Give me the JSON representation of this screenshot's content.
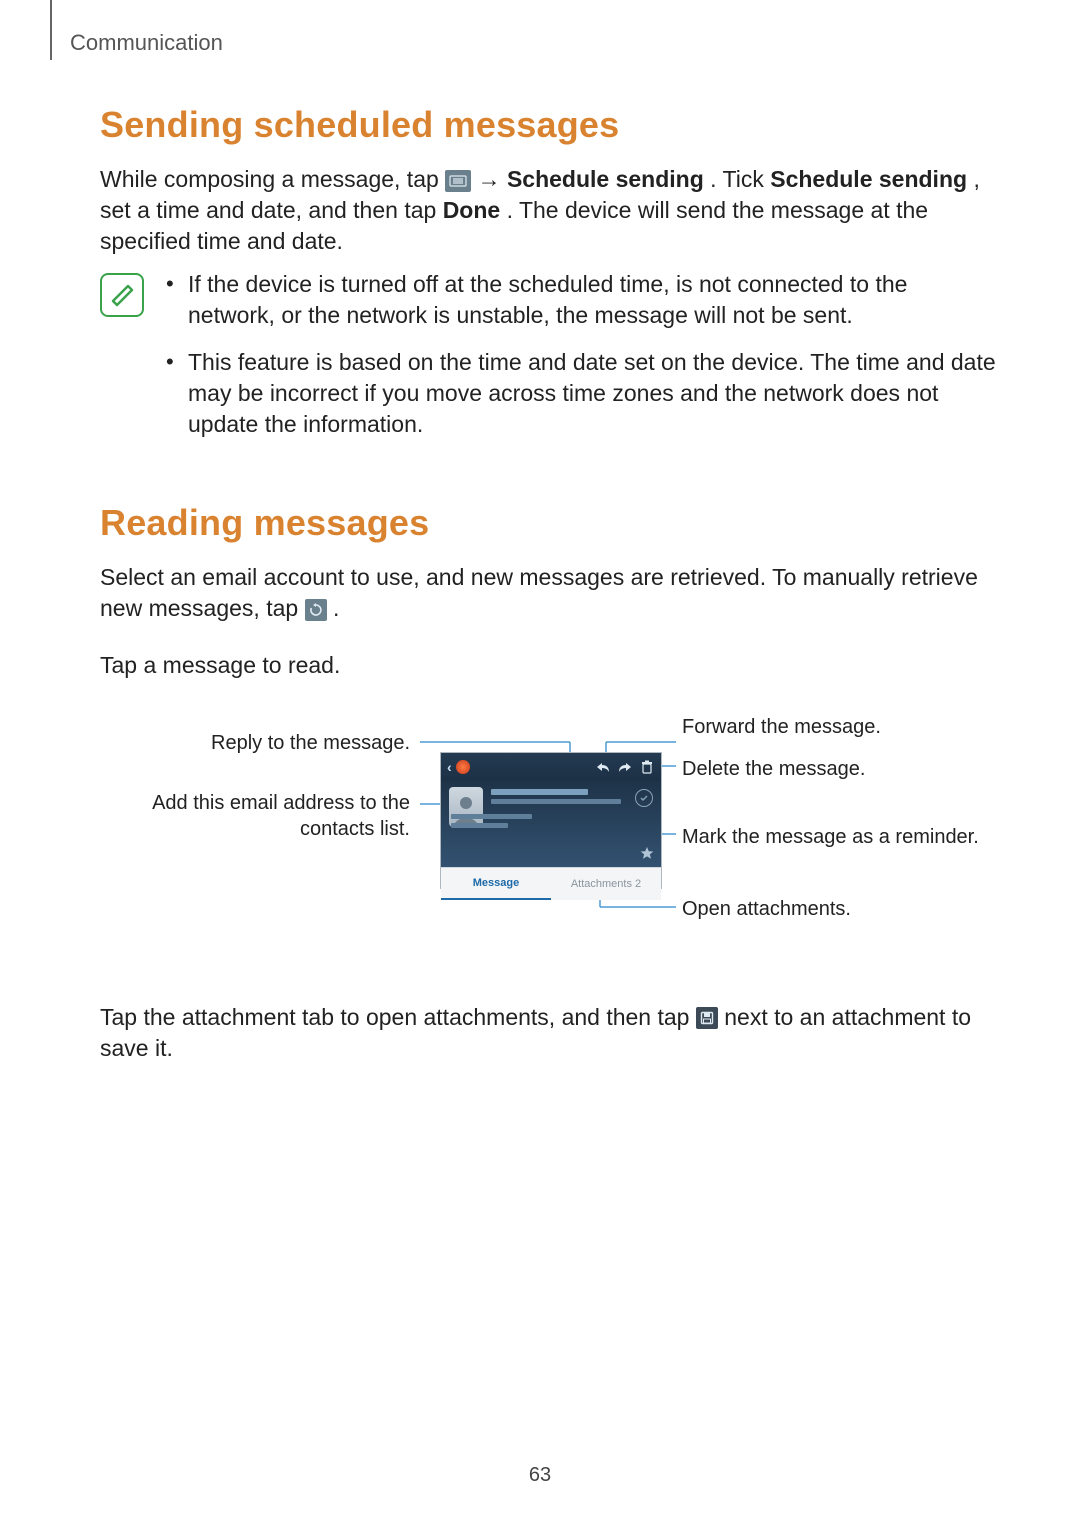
{
  "breadcrumb": "Communication",
  "page_number": "63",
  "section1": {
    "heading": "Sending scheduled messages",
    "para_parts": {
      "p1": "While composing a message, tap ",
      "arrow": " → ",
      "b1": "Schedule sending",
      "p2": ". Tick ",
      "b2": "Schedule sending",
      "p3": ", set a time and date, and then tap ",
      "b3": "Done",
      "p4": ". The device will send the message at the specified time and date."
    },
    "notes": {
      "n1": "If the device is turned off at the scheduled time, is not connected to the network, or the network is unstable, the message will not be sent.",
      "n2": "This feature is based on the time and date set on the device. The time and date may be incorrect if you move across time zones and the network does not update the information."
    }
  },
  "section2": {
    "heading": "Reading messages",
    "para1_parts": {
      "p1": "Select an email account to use, and new messages are retrieved. To manually retrieve new messages, tap ",
      "p2": "."
    },
    "para2": "Tap a message to read.",
    "para3_parts": {
      "p1": "Tap the attachment tab to open attachments, and then tap ",
      "p2": " next to an attachment to save it."
    }
  },
  "diagram": {
    "tabs": {
      "message": "Message",
      "attachments": "Attachments 2"
    },
    "callouts": {
      "reply": "Reply to the message.",
      "add_contact": "Add this email address to the contacts list.",
      "forward": "Forward the message.",
      "delete": "Delete the message.",
      "star": "Mark the message as a reminder.",
      "attachments": "Open attachments."
    }
  }
}
